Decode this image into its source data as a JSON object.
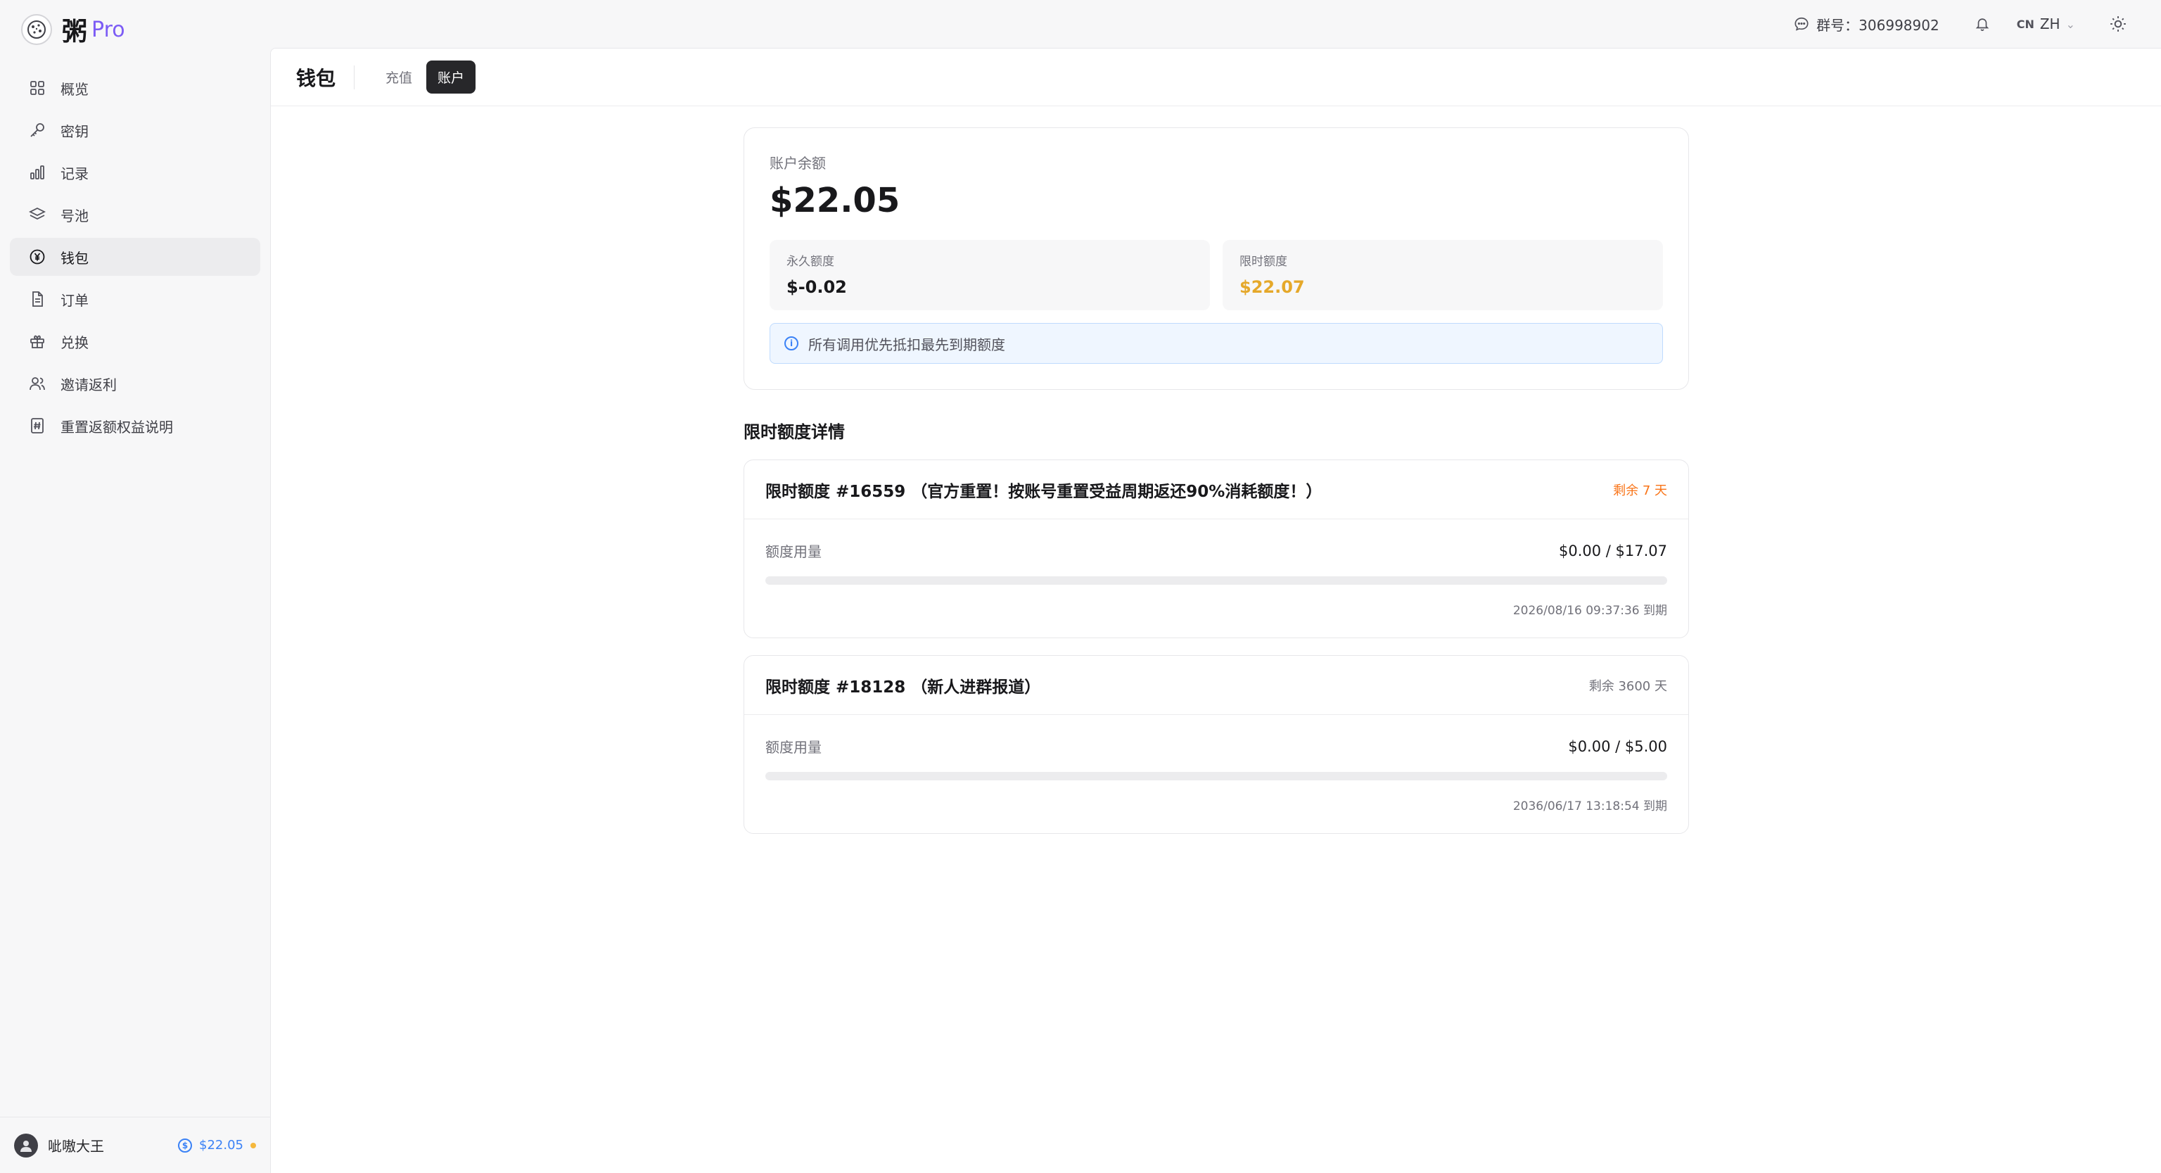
{
  "brand": {
    "name": "粥",
    "suffix": "Pro",
    "logo_icon": "cookie-icon"
  },
  "sidebar": {
    "items": [
      {
        "label": "概览",
        "icon": "grid-icon",
        "active": false
      },
      {
        "label": "密钥",
        "icon": "key-icon",
        "active": false
      },
      {
        "label": "记录",
        "icon": "bar-chart-icon",
        "active": false
      },
      {
        "label": "号池",
        "icon": "layers-icon",
        "active": false
      },
      {
        "label": "钱包",
        "icon": "yen-circle-icon",
        "active": true
      },
      {
        "label": "订单",
        "icon": "document-icon",
        "active": false
      },
      {
        "label": "兑换",
        "icon": "gift-icon",
        "active": false
      },
      {
        "label": "邀请返利",
        "icon": "users-icon",
        "active": false
      },
      {
        "label": "重置返额权益说明",
        "icon": "hash-file-icon",
        "active": false
      }
    ]
  },
  "user": {
    "name": "呲嗷大王",
    "balance": "$22.05"
  },
  "topbar": {
    "group_label": "群号：306998902",
    "lang_flag": "CN",
    "lang": "ZH"
  },
  "page": {
    "title": "钱包",
    "tabs": [
      {
        "label": "充值",
        "active": false
      },
      {
        "label": "账户",
        "active": true
      }
    ]
  },
  "balance": {
    "label": "账户余额",
    "value": "$22.05",
    "permanent_label": "永久额度",
    "permanent_value": "$-0.02",
    "limited_label": "限时额度",
    "limited_value": "$22.07",
    "notice": "所有调用优先抵扣最先到期额度"
  },
  "limited_section": {
    "title": "限时额度详情",
    "items": [
      {
        "title": "限时额度 #16559 （官方重置！按账号重置受益周期返还90%消耗额度！）",
        "remaining": "剩余 7 天",
        "usage_label": "额度用量",
        "usage_value": "$0.00 / $17.07",
        "progress": 0,
        "expire": "2026/08/16 09:37:36 到期"
      },
      {
        "title": "限时额度 #18128 （新人进群报道）",
        "remaining": "剩余 3600 天",
        "usage_label": "额度用量",
        "usage_value": "$0.00 / $5.00",
        "progress": 0,
        "expire": "2036/06/17 13:18:54 到期"
      }
    ]
  },
  "colors": {
    "accent": "#7c5cf5",
    "gold": "#e5a82a",
    "warning": "#f97316",
    "info": "#3b82f6"
  }
}
